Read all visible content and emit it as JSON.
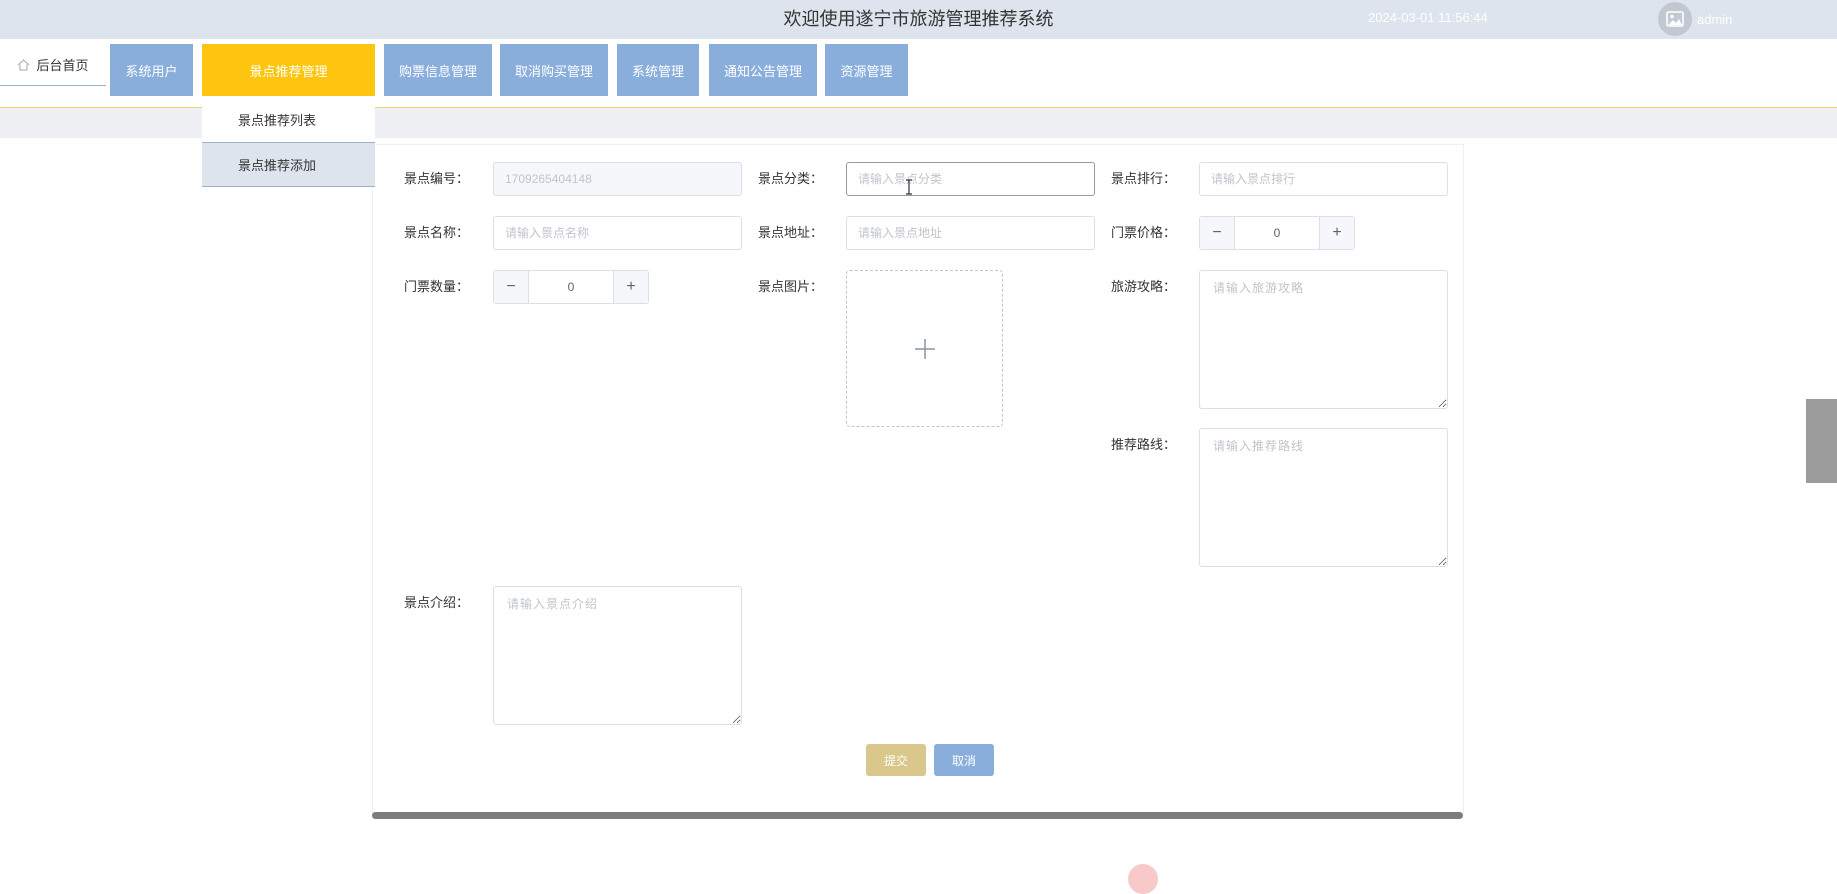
{
  "header": {
    "title": "欢迎使用遂宁市旅游管理推荐系统",
    "datetime": "2024-03-01 11:56:44",
    "username": "admin",
    "avatar_icon": "image-icon"
  },
  "nav": {
    "home_label": "后台首页",
    "home_icon": "home-icon",
    "items": [
      {
        "label": "系统用户"
      },
      {
        "label": "景点推荐管理",
        "active": true
      },
      {
        "label": "购票信息管理"
      },
      {
        "label": "取消购买管理"
      },
      {
        "label": "系统管理"
      },
      {
        "label": "通知公告管理"
      },
      {
        "label": "资源管理"
      }
    ],
    "colors": {
      "normal": "#8aaedb",
      "active": "#fdc50f"
    }
  },
  "dropdown": {
    "items": [
      {
        "label": "景点推荐列表"
      },
      {
        "label": "景点推荐添加",
        "active": true
      }
    ]
  },
  "form": {
    "code": {
      "label": "景点编号：",
      "value": "1709265404148"
    },
    "category": {
      "label": "景点分类：",
      "placeholder": "请输入景点分类"
    },
    "rank": {
      "label": "景点排行：",
      "placeholder": "请输入景点排行"
    },
    "name": {
      "label": "景点名称：",
      "placeholder": "请输入景点名称"
    },
    "address": {
      "label": "景点地址：",
      "placeholder": "请输入景点地址"
    },
    "price": {
      "label": "门票价格：",
      "value": "0"
    },
    "quantity": {
      "label": "门票数量：",
      "value": "0"
    },
    "image": {
      "label": "景点图片："
    },
    "guide": {
      "label": "旅游攻略：",
      "placeholder": "请输入旅游攻略"
    },
    "route": {
      "label": "推荐路线：",
      "placeholder": "请输入推荐路线"
    },
    "intro": {
      "label": "景点介绍：",
      "placeholder": "请输入景点介绍"
    },
    "stepper_minus": "−",
    "stepper_plus": "+",
    "submit_label": "提交",
    "cancel_label": "取消"
  }
}
